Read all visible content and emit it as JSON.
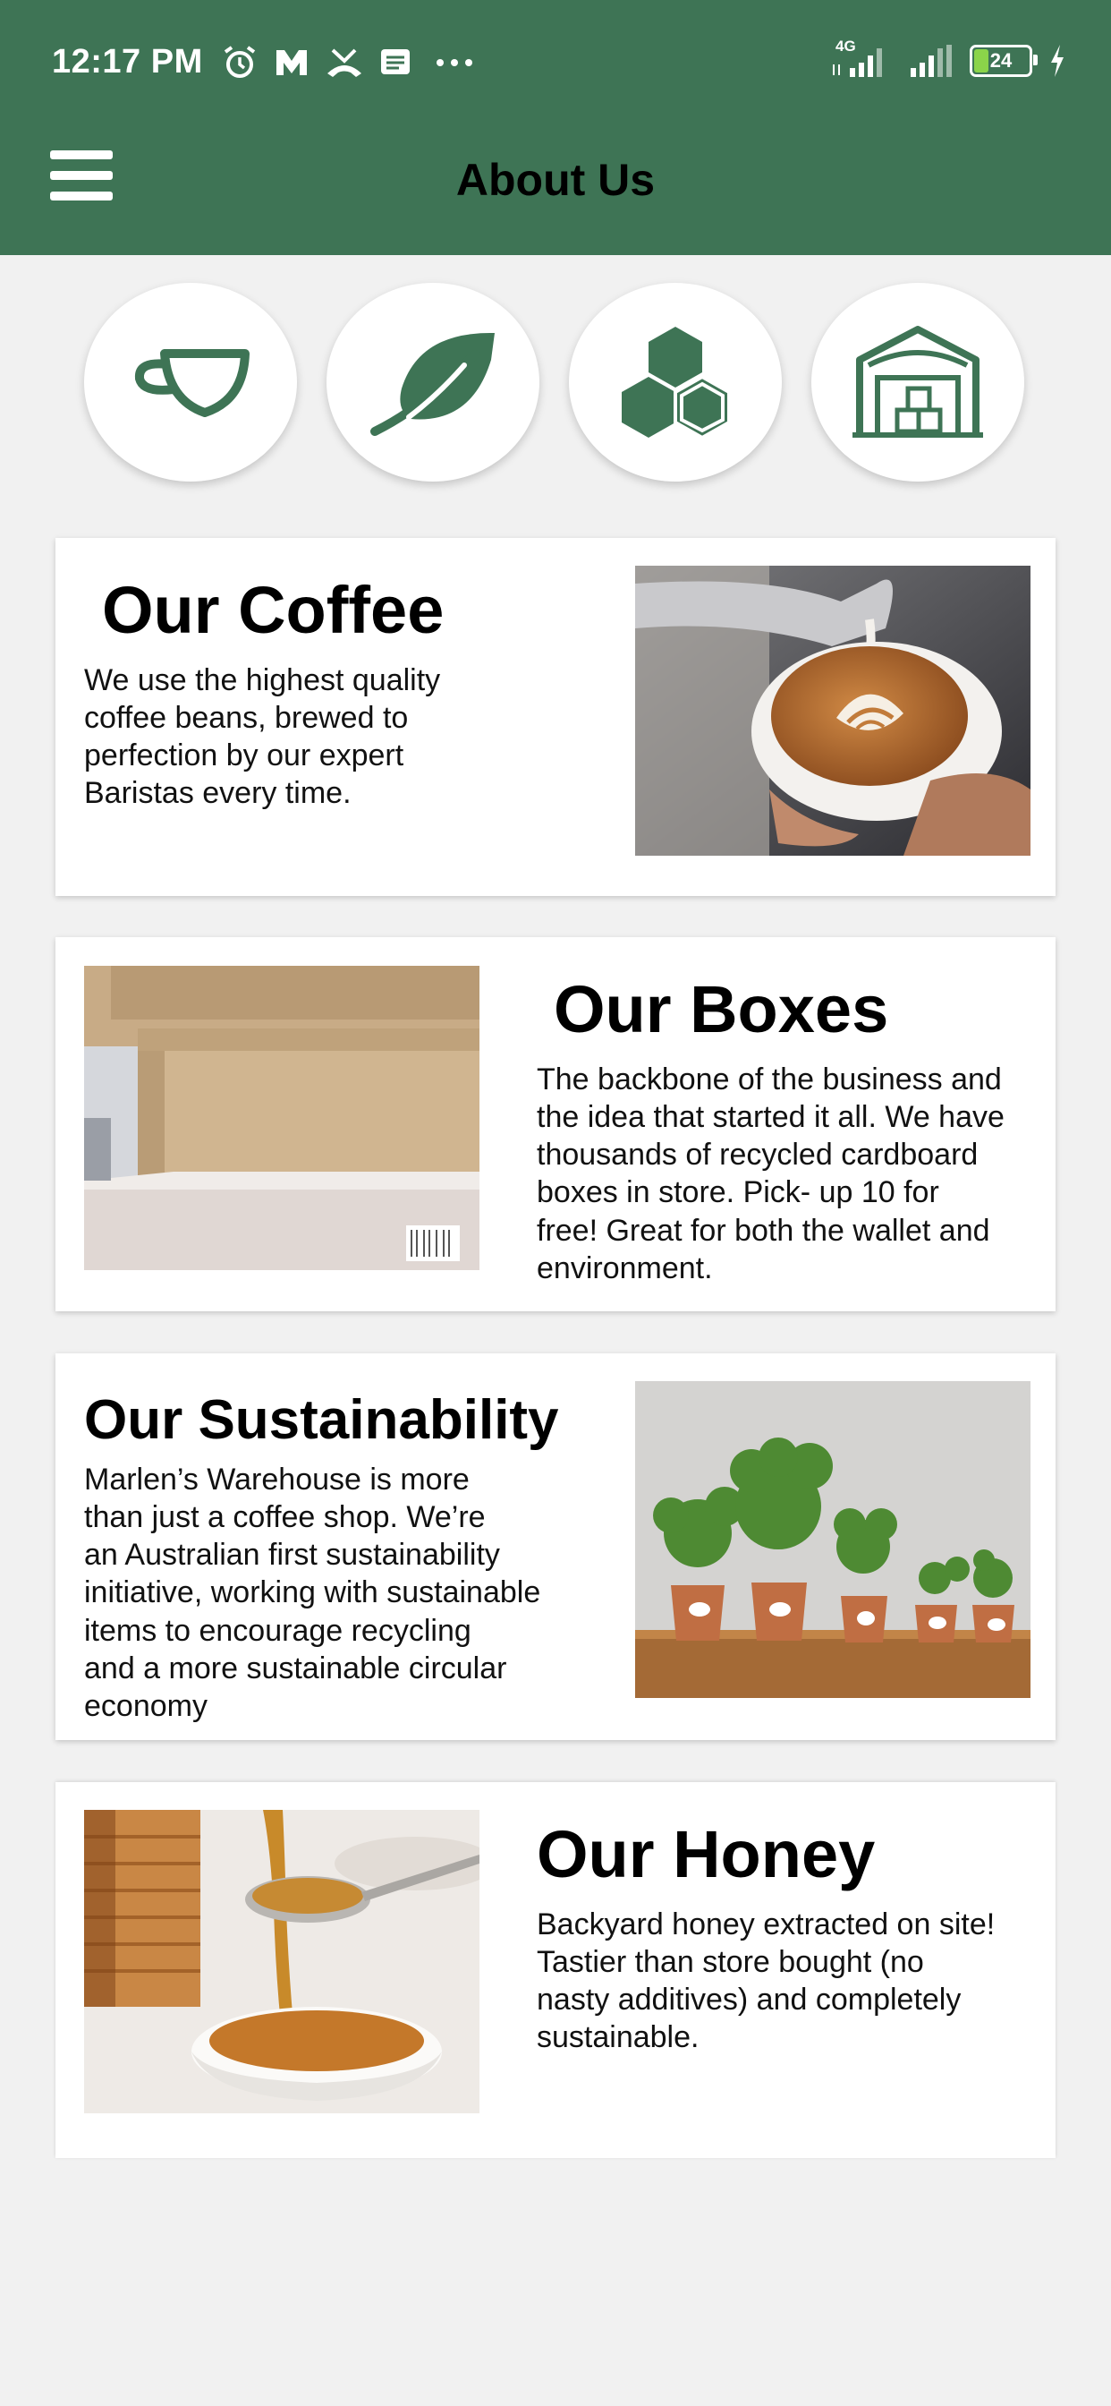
{
  "status_bar": {
    "time": "12:17 PM",
    "network_label": "4G",
    "battery": "24",
    "icons_left": [
      "alarm-icon",
      "m-app-icon",
      "missed-call-icon",
      "message-icon",
      "more-dots-icon"
    ],
    "icons_right": [
      "4g-signal-icon",
      "signal-icon",
      "battery-icon",
      "charging-icon"
    ]
  },
  "app_bar": {
    "title": "About Us",
    "menu_icon": "hamburger-menu-icon"
  },
  "categories": [
    {
      "icon": "coffee-cup-icon"
    },
    {
      "icon": "leaf-icon"
    },
    {
      "icon": "honeycomb-icon"
    },
    {
      "icon": "warehouse-icon"
    }
  ],
  "sections": [
    {
      "title": "Our Coffee",
      "text_lines": [
        "We use the highest quality",
        "coffee beans, brewed to",
        "perfection by our expert",
        "Baristas every time."
      ],
      "image": "latte-art-photo"
    },
    {
      "title": "Our Boxes",
      "text_lines": [
        "The backbone of the business and",
        "the idea that started it all. We have",
        "thousands of recycled cardboard",
        "boxes in store. Pick- up 10 for",
        "free! Great for both the wallet and",
        "environment."
      ],
      "image": "cardboard-boxes-photo"
    },
    {
      "title": "Our Sustainability",
      "text_lines": [
        "Marlen’s Warehouse is more",
        "than just a coffee shop. We’re",
        "an Australian first sustainability",
        "initiative, working with sustainable",
        "items to encourage recycling",
        "and a more sustainable circular",
        "economy"
      ],
      "image": "potted-plants-photo"
    },
    {
      "title": "Our Honey",
      "text_lines": [
        "Backyard honey extracted on site!",
        "Tastier than store bought (no",
        "nasty additives) and completely",
        "sustainable."
      ],
      "image": "honey-spoon-photo"
    }
  ],
  "colors": {
    "brand_green": "#3e7455",
    "background": "#f1f1f1",
    "card": "#ffffff"
  }
}
